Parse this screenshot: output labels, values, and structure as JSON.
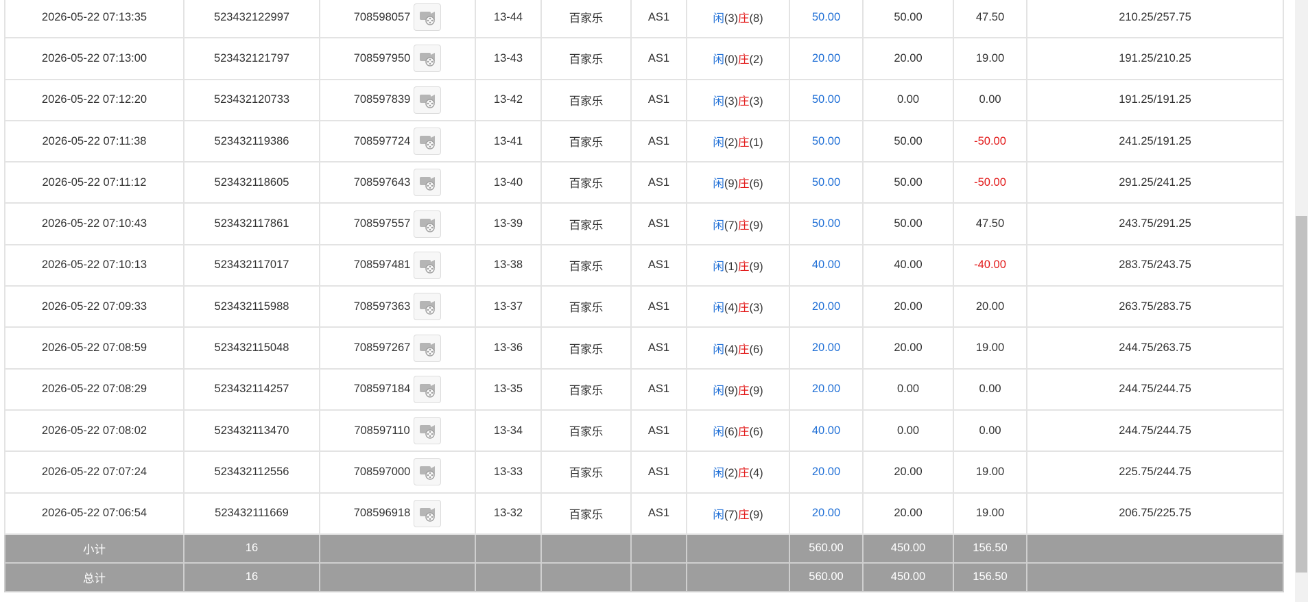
{
  "rows": [
    {
      "time": "2026-05-22 07:13:35",
      "bet_no": "523432122997",
      "game_id": "708598057",
      "shoe": "13-44",
      "game": "百家乐",
      "table": "AS1",
      "player_label": "闲",
      "player_score": "(3)",
      "banker_label": "庄",
      "banker_score": "(8)",
      "bet": "50.00",
      "valid": "50.00",
      "win": "47.50",
      "win_color": "normal",
      "balance": "210.25/257.75"
    },
    {
      "time": "2026-05-22 07:13:00",
      "bet_no": "523432121797",
      "game_id": "708597950",
      "shoe": "13-43",
      "game": "百家乐",
      "table": "AS1",
      "player_label": "闲",
      "player_score": "(0)",
      "banker_label": "庄",
      "banker_score": "(2)",
      "bet": "20.00",
      "valid": "20.00",
      "win": "19.00",
      "win_color": "normal",
      "balance": "191.25/210.25"
    },
    {
      "time": "2026-05-22 07:12:20",
      "bet_no": "523432120733",
      "game_id": "708597839",
      "shoe": "13-42",
      "game": "百家乐",
      "table": "AS1",
      "player_label": "闲",
      "player_score": "(3)",
      "banker_label": "庄",
      "banker_score": "(3)",
      "bet": "50.00",
      "valid": "0.00",
      "win": "0.00",
      "win_color": "normal",
      "balance": "191.25/191.25"
    },
    {
      "time": "2026-05-22 07:11:38",
      "bet_no": "523432119386",
      "game_id": "708597724",
      "shoe": "13-41",
      "game": "百家乐",
      "table": "AS1",
      "player_label": "闲",
      "player_score": "(2)",
      "banker_label": "庄",
      "banker_score": "(1)",
      "bet": "50.00",
      "valid": "50.00",
      "win": "-50.00",
      "win_color": "negative",
      "balance": "241.25/191.25"
    },
    {
      "time": "2026-05-22 07:11:12",
      "bet_no": "523432118605",
      "game_id": "708597643",
      "shoe": "13-40",
      "game": "百家乐",
      "table": "AS1",
      "player_label": "闲",
      "player_score": "(9)",
      "banker_label": "庄",
      "banker_score": "(6)",
      "bet": "50.00",
      "valid": "50.00",
      "win": "-50.00",
      "win_color": "negative",
      "balance": "291.25/241.25"
    },
    {
      "time": "2026-05-22 07:10:43",
      "bet_no": "523432117861",
      "game_id": "708597557",
      "shoe": "13-39",
      "game": "百家乐",
      "table": "AS1",
      "player_label": "闲",
      "player_score": "(7)",
      "banker_label": "庄",
      "banker_score": "(9)",
      "bet": "50.00",
      "valid": "50.00",
      "win": "47.50",
      "win_color": "normal",
      "balance": "243.75/291.25"
    },
    {
      "time": "2026-05-22 07:10:13",
      "bet_no": "523432117017",
      "game_id": "708597481",
      "shoe": "13-38",
      "game": "百家乐",
      "table": "AS1",
      "player_label": "闲",
      "player_score": "(1)",
      "banker_label": "庄",
      "banker_score": "(9)",
      "bet": "40.00",
      "valid": "40.00",
      "win": "-40.00",
      "win_color": "negative",
      "balance": "283.75/243.75"
    },
    {
      "time": "2026-05-22 07:09:33",
      "bet_no": "523432115988",
      "game_id": "708597363",
      "shoe": "13-37",
      "game": "百家乐",
      "table": "AS1",
      "player_label": "闲",
      "player_score": "(4)",
      "banker_label": "庄",
      "banker_score": "(3)",
      "bet": "20.00",
      "valid": "20.00",
      "win": "20.00",
      "win_color": "normal",
      "balance": "263.75/283.75"
    },
    {
      "time": "2026-05-22 07:08:59",
      "bet_no": "523432115048",
      "game_id": "708597267",
      "shoe": "13-36",
      "game": "百家乐",
      "table": "AS1",
      "player_label": "闲",
      "player_score": "(4)",
      "banker_label": "庄",
      "banker_score": "(6)",
      "bet": "20.00",
      "valid": "20.00",
      "win": "19.00",
      "win_color": "normal",
      "balance": "244.75/263.75"
    },
    {
      "time": "2026-05-22 07:08:29",
      "bet_no": "523432114257",
      "game_id": "708597184",
      "shoe": "13-35",
      "game": "百家乐",
      "table": "AS1",
      "player_label": "闲",
      "player_score": "(9)",
      "banker_label": "庄",
      "banker_score": "(9)",
      "bet": "20.00",
      "valid": "0.00",
      "win": "0.00",
      "win_color": "normal",
      "balance": "244.75/244.75"
    },
    {
      "time": "2026-05-22 07:08:02",
      "bet_no": "523432113470",
      "game_id": "708597110",
      "shoe": "13-34",
      "game": "百家乐",
      "table": "AS1",
      "player_label": "闲",
      "player_score": "(6)",
      "banker_label": "庄",
      "banker_score": "(6)",
      "bet": "40.00",
      "valid": "0.00",
      "win": "0.00",
      "win_color": "normal",
      "balance": "244.75/244.75"
    },
    {
      "time": "2026-05-22 07:07:24",
      "bet_no": "523432112556",
      "game_id": "708597000",
      "shoe": "13-33",
      "game": "百家乐",
      "table": "AS1",
      "player_label": "闲",
      "player_score": "(2)",
      "banker_label": "庄",
      "banker_score": "(4)",
      "bet": "20.00",
      "valid": "20.00",
      "win": "19.00",
      "win_color": "normal",
      "balance": "225.75/244.75"
    },
    {
      "time": "2026-05-22 07:06:54",
      "bet_no": "523432111669",
      "game_id": "708596918",
      "shoe": "13-32",
      "game": "百家乐",
      "table": "AS1",
      "player_label": "闲",
      "player_score": "(7)",
      "banker_label": "庄",
      "banker_score": "(9)",
      "bet": "20.00",
      "valid": "20.00",
      "win": "19.00",
      "win_color": "normal",
      "balance": "206.75/225.75"
    }
  ],
  "subtotal": {
    "label": "小计",
    "count": "16",
    "bet": "560.00",
    "valid": "450.00",
    "win": "156.50"
  },
  "total": {
    "label": "总计",
    "count": "16",
    "bet": "560.00",
    "valid": "450.00",
    "win": "156.50"
  },
  "colors": {
    "player": "#1f6fd6",
    "banker": "#e21a1a",
    "negative": "#e21a1a",
    "bet": "#1f6fd6",
    "summary_bg": "#9e9e9e"
  },
  "icons": {
    "replay": "video-replay-icon"
  }
}
